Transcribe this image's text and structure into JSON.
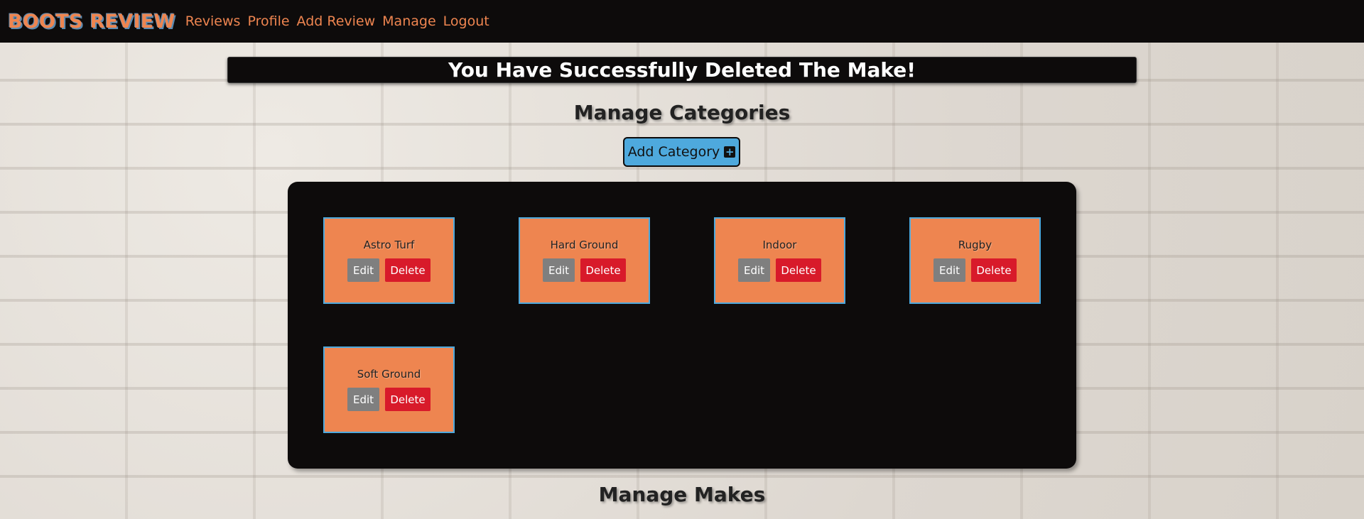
{
  "nav": {
    "brand": "BOOTS REVIEW",
    "links": [
      "Reviews",
      "Profile",
      "Add Review",
      "Manage",
      "Logout"
    ]
  },
  "flash_message": "You Have Successfully Deleted The Make!",
  "categories_section": {
    "title": "Manage Categories",
    "add_button_label": "Add Category",
    "add_icon": "plus-square-icon",
    "items": [
      {
        "name": "Astro Turf",
        "edit_label": "Edit",
        "delete_label": "Delete"
      },
      {
        "name": "Hard Ground",
        "edit_label": "Edit",
        "delete_label": "Delete"
      },
      {
        "name": "Indoor",
        "edit_label": "Edit",
        "delete_label": "Delete"
      },
      {
        "name": "Rugby",
        "edit_label": "Edit",
        "delete_label": "Delete"
      },
      {
        "name": "Soft Ground",
        "edit_label": "Edit",
        "delete_label": "Delete"
      }
    ]
  },
  "makes_section": {
    "title": "Manage Makes"
  },
  "colors": {
    "accent_orange": "#ee8550",
    "accent_blue": "#4ea9dd",
    "delete_red": "#d81a2a",
    "edit_gray": "#7f7f7f",
    "dark": "#0d0b0b"
  }
}
